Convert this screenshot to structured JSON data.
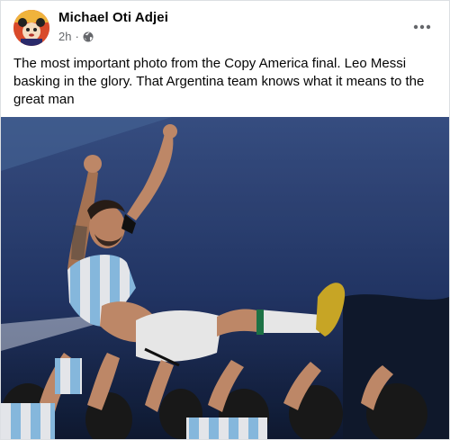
{
  "post": {
    "author": "Michael Oti Adjei",
    "time": "2h",
    "separator": "·",
    "caption": "The most important photo from the Copy America final. Leo Messi basking in the glory. That Argentina team knows what it means to the great man",
    "privacy_icon": "globe-icon",
    "menu_icon": "more-options-icon"
  },
  "colors": {
    "text_primary": "#050505",
    "text_secondary": "#65676b",
    "border": "#dcdfe3"
  }
}
